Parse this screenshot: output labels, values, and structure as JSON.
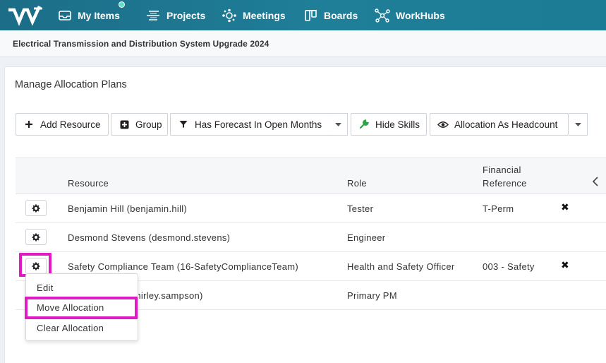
{
  "nav": {
    "items": [
      {
        "label": "My Items",
        "icon": "inbox-icon"
      },
      {
        "label": "Projects",
        "icon": "projects-icon"
      },
      {
        "label": "Meetings",
        "icon": "meetings-icon"
      },
      {
        "label": "Boards",
        "icon": "boards-icon"
      },
      {
        "label": "WorkHubs",
        "icon": "workhubs-icon"
      }
    ],
    "notification_color": "#5fe0c8"
  },
  "project": {
    "title": "Electrical Transmission and Distribution System Upgrade 2024"
  },
  "page": {
    "title": "Manage Allocation Plans"
  },
  "toolbar": {
    "add_resource": "Add Resource",
    "group": "Group",
    "forecast_filter": "Has Forecast In Open Months",
    "hide_skills": "Hide Skills",
    "allocation_mode": "Allocation As Headcount"
  },
  "table": {
    "headers": {
      "resource": "Resource",
      "role": "Role",
      "financial_reference_1": "Financial",
      "financial_reference_2": "Reference"
    },
    "rows": [
      {
        "resource": "Benjamin Hill (benjamin.hill)",
        "role": "Tester",
        "financial": "T-Perm",
        "remove": "✖"
      },
      {
        "resource": "Desmond Stevens (desmond.stevens)",
        "role": "Engineer",
        "financial": "",
        "remove": ""
      },
      {
        "resource": "Safety Compliance Team (16-SafetyComplianceTeam)",
        "role": "Health and Safety Officer",
        "financial": "003 - Safety",
        "remove": "✖"
      },
      {
        "resource": "on (shirley.sampson)",
        "role": "Primary PM",
        "financial": "",
        "remove": ""
      }
    ]
  },
  "context_menu": {
    "items": [
      "Edit",
      "Move Allocation",
      "Clear Allocation"
    ]
  },
  "colors": {
    "highlight": "#e01bc4",
    "nav_bg": "#1c7a94"
  }
}
